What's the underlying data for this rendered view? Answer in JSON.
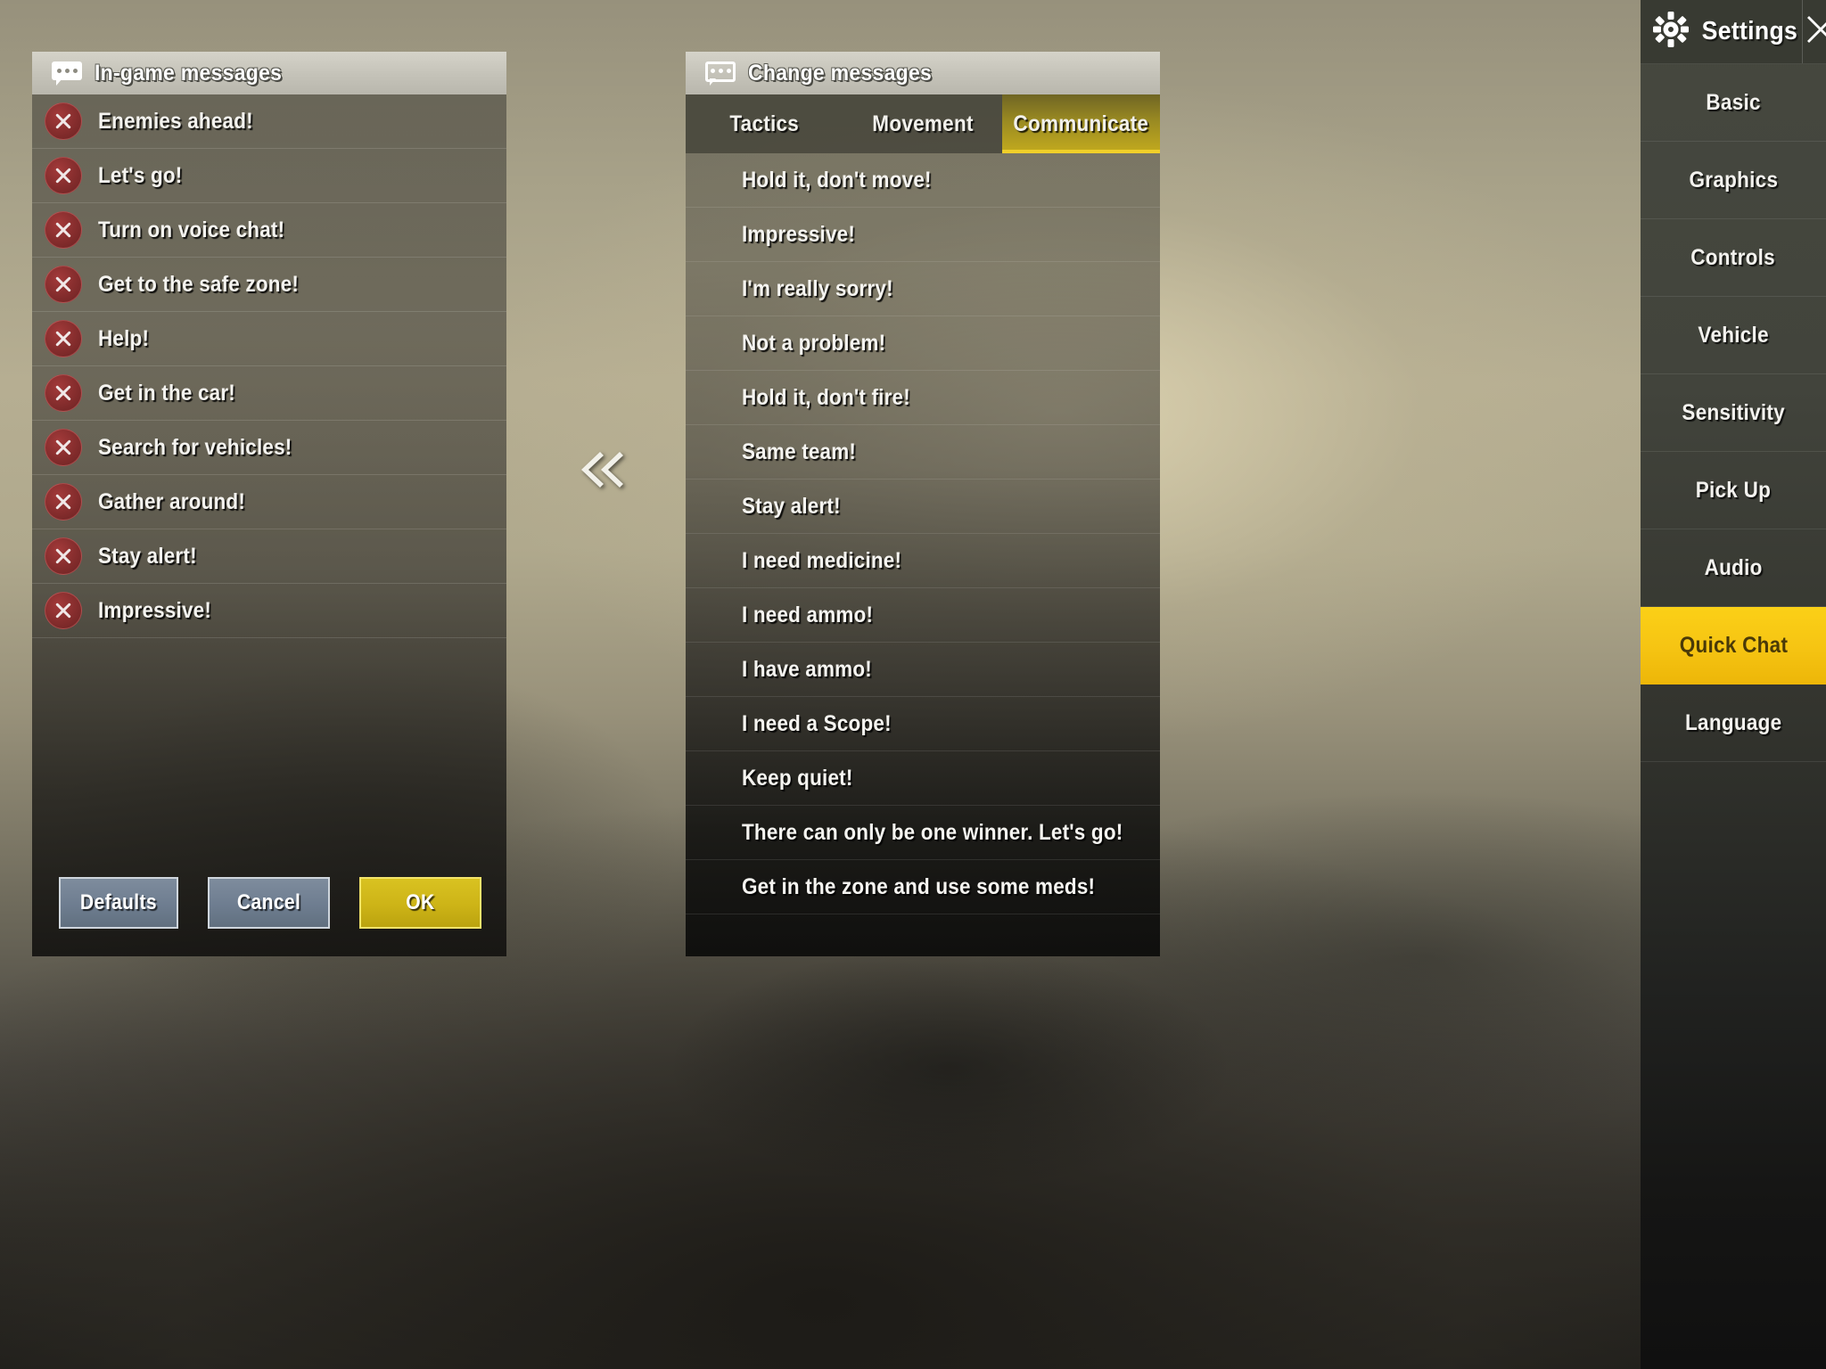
{
  "theme": {
    "accent_gold": "#f6c513",
    "tab_gold": "#c3ab1e",
    "delete_red": "#8a2f2f",
    "button_gray": "#6e7d90",
    "ok_gold": "#cdb417"
  },
  "left_panel": {
    "title": "In-game messages",
    "icon": "chat-bubble-icon",
    "messages": [
      "Enemies ahead!",
      "Let's go!",
      "Turn on voice chat!",
      "Get to the safe zone!",
      "Help!",
      "Get in the car!",
      "Search for vehicles!",
      "Gather around!",
      "Stay alert!",
      "Impressive!"
    ],
    "delete_icon": "close-circle-icon"
  },
  "transfer": {
    "icon": "double-chevron-left-icon"
  },
  "buttons": {
    "defaults": "Defaults",
    "cancel": "Cancel",
    "ok": "OK"
  },
  "right_panel": {
    "title": "Change messages",
    "icon": "chat-bubble-outline-icon",
    "tabs": [
      {
        "label": "Tactics",
        "active": false
      },
      {
        "label": "Movement",
        "active": false
      },
      {
        "label": "Communicate",
        "active": true
      }
    ],
    "options": [
      "Hold it, don't move!",
      "Impressive!",
      "I'm really sorry!",
      "Not a problem!",
      "Hold it, don't fire!",
      "Same team!",
      "Stay alert!",
      "I need medicine!",
      "I need ammo!",
      "I have ammo!",
      "I need a Scope!",
      "Keep quiet!",
      "There can only be one winner. Let's go!",
      "Get in the zone and use some meds!"
    ]
  },
  "sidebar": {
    "title": "Settings",
    "gear_icon": "gear-icon",
    "close_icon": "close-icon",
    "items": [
      {
        "label": "Basic",
        "active": false
      },
      {
        "label": "Graphics",
        "active": false
      },
      {
        "label": "Controls",
        "active": false
      },
      {
        "label": "Vehicle",
        "active": false
      },
      {
        "label": "Sensitivity",
        "active": false
      },
      {
        "label": "Pick Up",
        "active": false
      },
      {
        "label": "Audio",
        "active": false
      },
      {
        "label": "Quick Chat",
        "active": true
      },
      {
        "label": "Language",
        "active": false
      }
    ]
  }
}
